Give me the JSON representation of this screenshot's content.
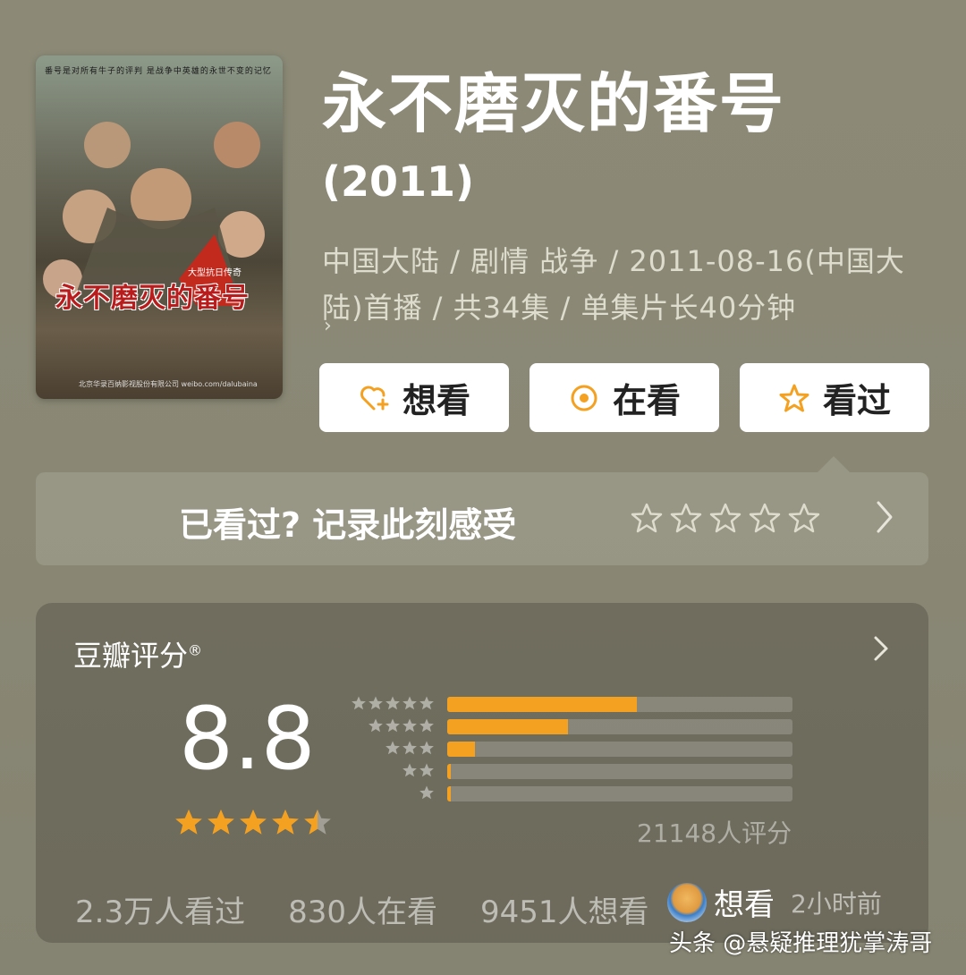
{
  "poster": {
    "top_text": "番号是对所有牛子的评判  是战争中英雄的永世不变的记忆",
    "title": "永不磨灭的番号",
    "subtitle": "大型抗日传奇",
    "credit": "北京华录百纳影视股份有限公司  weibo.com/dalubaina"
  },
  "show": {
    "title": "永不磨灭的番号",
    "year": "(2011)",
    "meta": "中国大陆 / 剧情 战争 / 2011-08-16(中国大陆)首播 / 共34集 / 单集片长40分钟",
    "meta_more": "›"
  },
  "actions": {
    "want": "想看",
    "watching": "在看",
    "watched": "看过"
  },
  "record": {
    "label": "已看过? 记录此刻感受",
    "chevron": "›"
  },
  "rating": {
    "title": "豆瓣评分",
    "reg": "®",
    "score": "8.8",
    "score_stars": 4.5,
    "distribution": [
      {
        "stars": 5,
        "percent": 55
      },
      {
        "stars": 4,
        "percent": 35
      },
      {
        "stars": 3,
        "percent": 8
      },
      {
        "stars": 2,
        "percent": 1
      },
      {
        "stars": 1,
        "percent": 1
      }
    ],
    "count": "21148人评分"
  },
  "stats": {
    "watched": "2.3万人看过",
    "watching": "830人在看",
    "want": "9451人想看"
  },
  "overlay": {
    "want": "想看",
    "time": "2小时前"
  },
  "watermark": "头条 @悬疑推理犹掌涛哥",
  "colors": {
    "accent": "#f4a121",
    "background": "#8a8875"
  }
}
